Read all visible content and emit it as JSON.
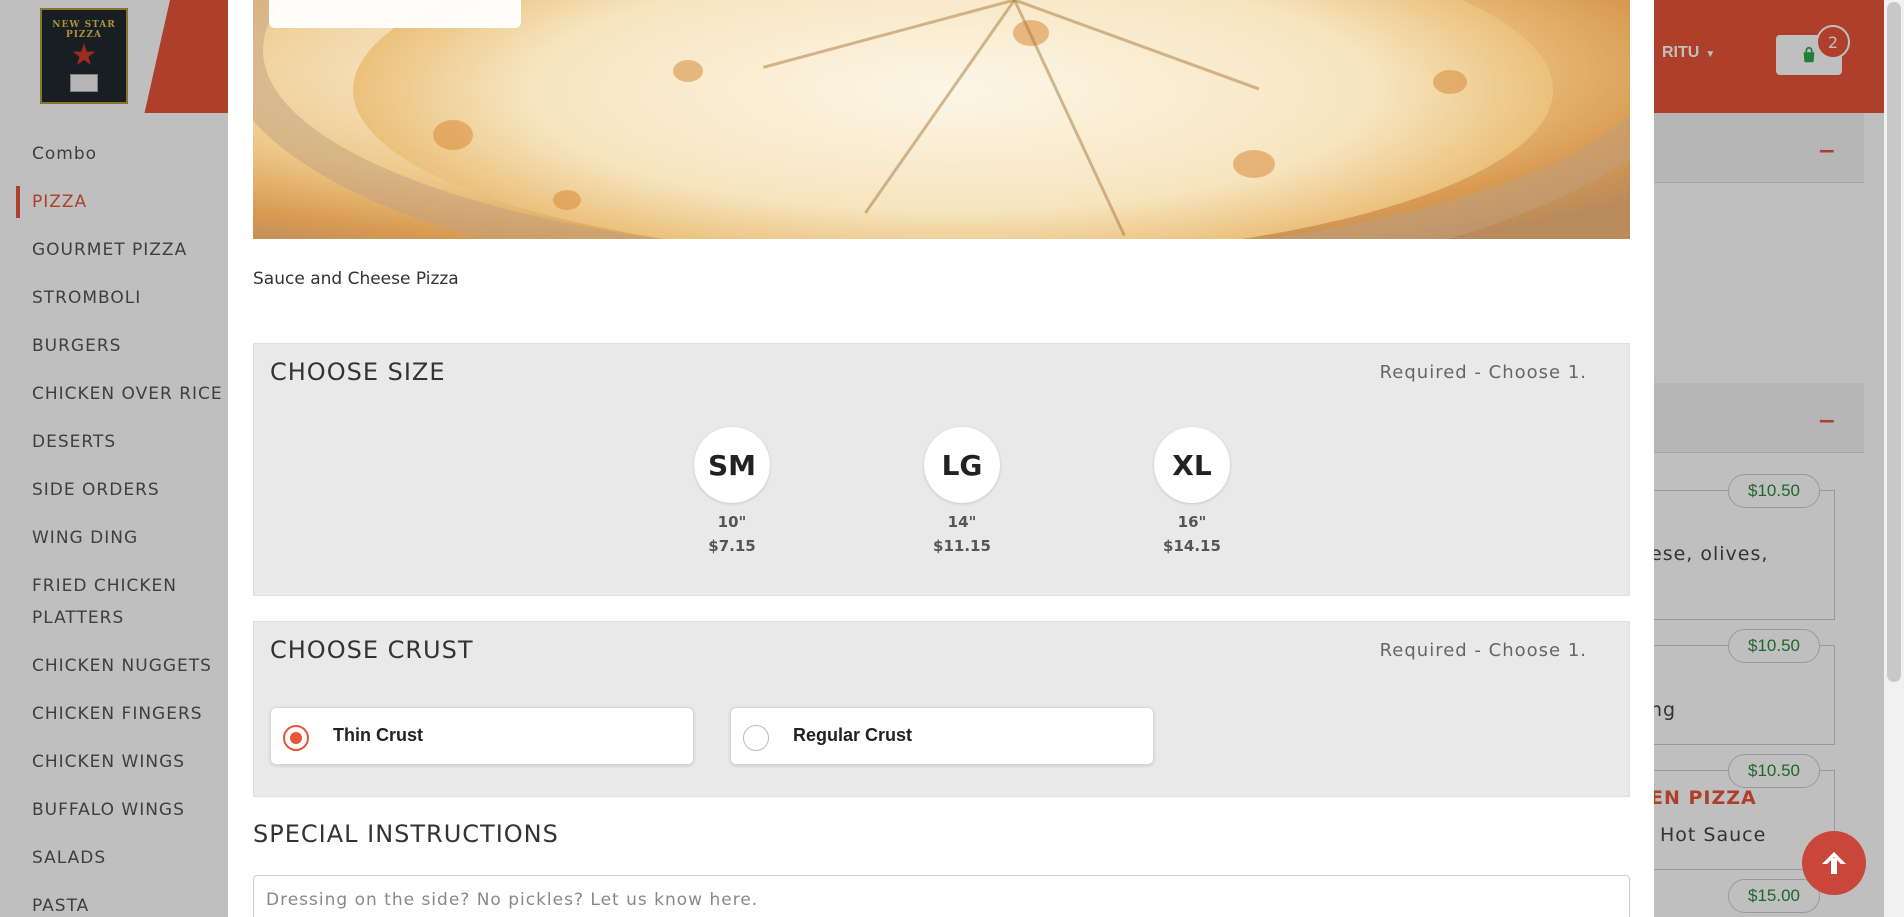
{
  "header": {
    "logo_text": "NEW STAR PIZZA",
    "user_name": "RITU",
    "cart_count": "2"
  },
  "sidebar": {
    "items": [
      {
        "label": "Combo"
      },
      {
        "label": "PIZZA",
        "active": true
      },
      {
        "label": "GOURMET PIZZA"
      },
      {
        "label": "STROMBOLI"
      },
      {
        "label": "BURGERS"
      },
      {
        "label": "CHICKEN OVER RICE"
      },
      {
        "label": "DESERTS"
      },
      {
        "label": "SIDE ORDERS"
      },
      {
        "label": "WING DING"
      },
      {
        "label": "FRIED CHICKEN PLATTERS"
      },
      {
        "label": "CHICKEN NUGGETS"
      },
      {
        "label": "CHICKEN FINGERS"
      },
      {
        "label": "CHICKEN WINGS"
      },
      {
        "label": "BUFFALO WINGS"
      },
      {
        "label": "SALADS"
      },
      {
        "label": "PASTA"
      }
    ]
  },
  "background_menu": {
    "prices": [
      "$10.50",
      "$10.50",
      "$10.50",
      "$15.00"
    ],
    "snippets": [
      "ese, olives,",
      "ng",
      "EN PIZZA",
      "Hot Sauce"
    ],
    "collapse_symbol": "−"
  },
  "modal": {
    "description": "Sauce and Cheese Pizza",
    "size_group": {
      "title": "CHOOSE SIZE",
      "requirement": "Required - Choose 1.",
      "options": [
        {
          "code": "SM",
          "inches": "10\"",
          "price": "$7.15"
        },
        {
          "code": "LG",
          "inches": "14\"",
          "price": "$11.15"
        },
        {
          "code": "XL",
          "inches": "16\"",
          "price": "$14.15"
        }
      ]
    },
    "crust_group": {
      "title": "CHOOSE CRUST",
      "requirement": "Required - Choose 1.",
      "options": [
        {
          "label": "Thin Crust",
          "selected": true
        },
        {
          "label": "Regular Crust",
          "selected": false
        }
      ]
    },
    "special": {
      "title": "SPECIAL INSTRUCTIONS",
      "placeholder": "Dressing on the side? No pickles? Let us know here."
    }
  },
  "colors": {
    "accent": "#e8553a",
    "price_green": "#2a8a3a"
  },
  "icons": {
    "cart": "shopping-bag-icon",
    "scroll_top": "arrow-up-icon"
  }
}
